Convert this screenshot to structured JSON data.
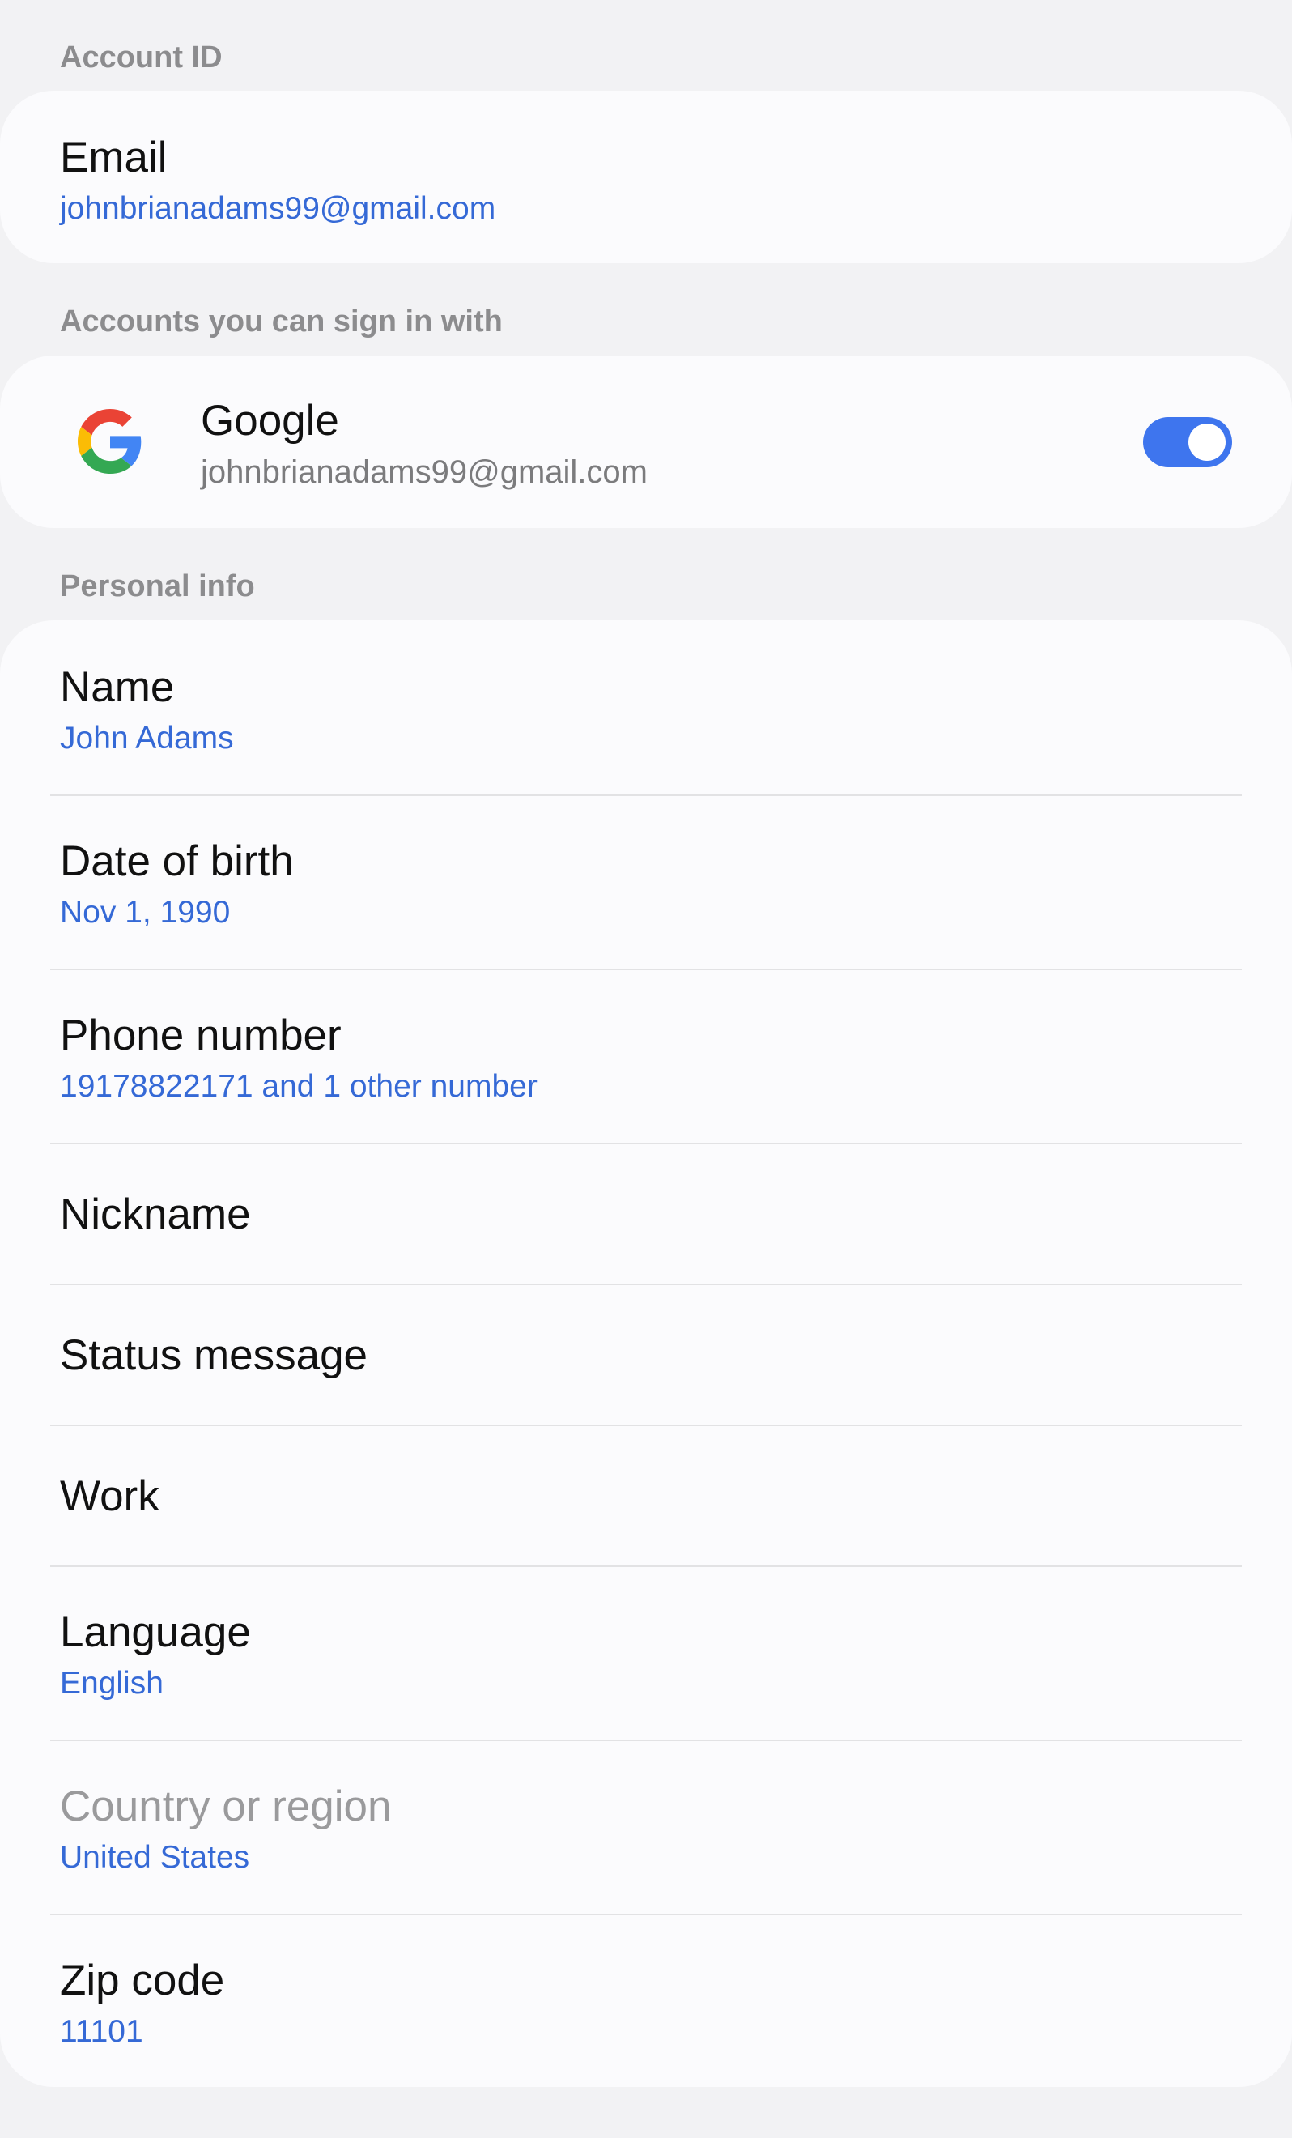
{
  "account_id": {
    "header": "Account ID",
    "email_title": "Email",
    "email_value": "johnbrianadams99@gmail.com"
  },
  "sign_in": {
    "header": "Accounts you can sign in with",
    "provider_icon": "google-g-icon",
    "provider_name": "Google",
    "provider_email": "johnbrianadams99@gmail.com",
    "toggle_on": true,
    "toggle_color": "#3e75ee"
  },
  "personal_info": {
    "header": "Personal info",
    "items": [
      {
        "title": "Name",
        "value": "John Adams"
      },
      {
        "title": "Date of birth",
        "value": "Nov 1, 1990"
      },
      {
        "title": "Phone number",
        "value": "19178822171 and 1 other number"
      },
      {
        "title": "Nickname",
        "value": ""
      },
      {
        "title": "Status message",
        "value": ""
      },
      {
        "title": "Work",
        "value": ""
      },
      {
        "title": "Language",
        "value": "English"
      },
      {
        "title": "Country or region",
        "value": "United States",
        "disabled": true
      },
      {
        "title": "Zip code",
        "value": "11101"
      }
    ]
  },
  "colors": {
    "accent": "#3569d6",
    "background": "#f2f2f4",
    "card": "#fbfbfd"
  }
}
